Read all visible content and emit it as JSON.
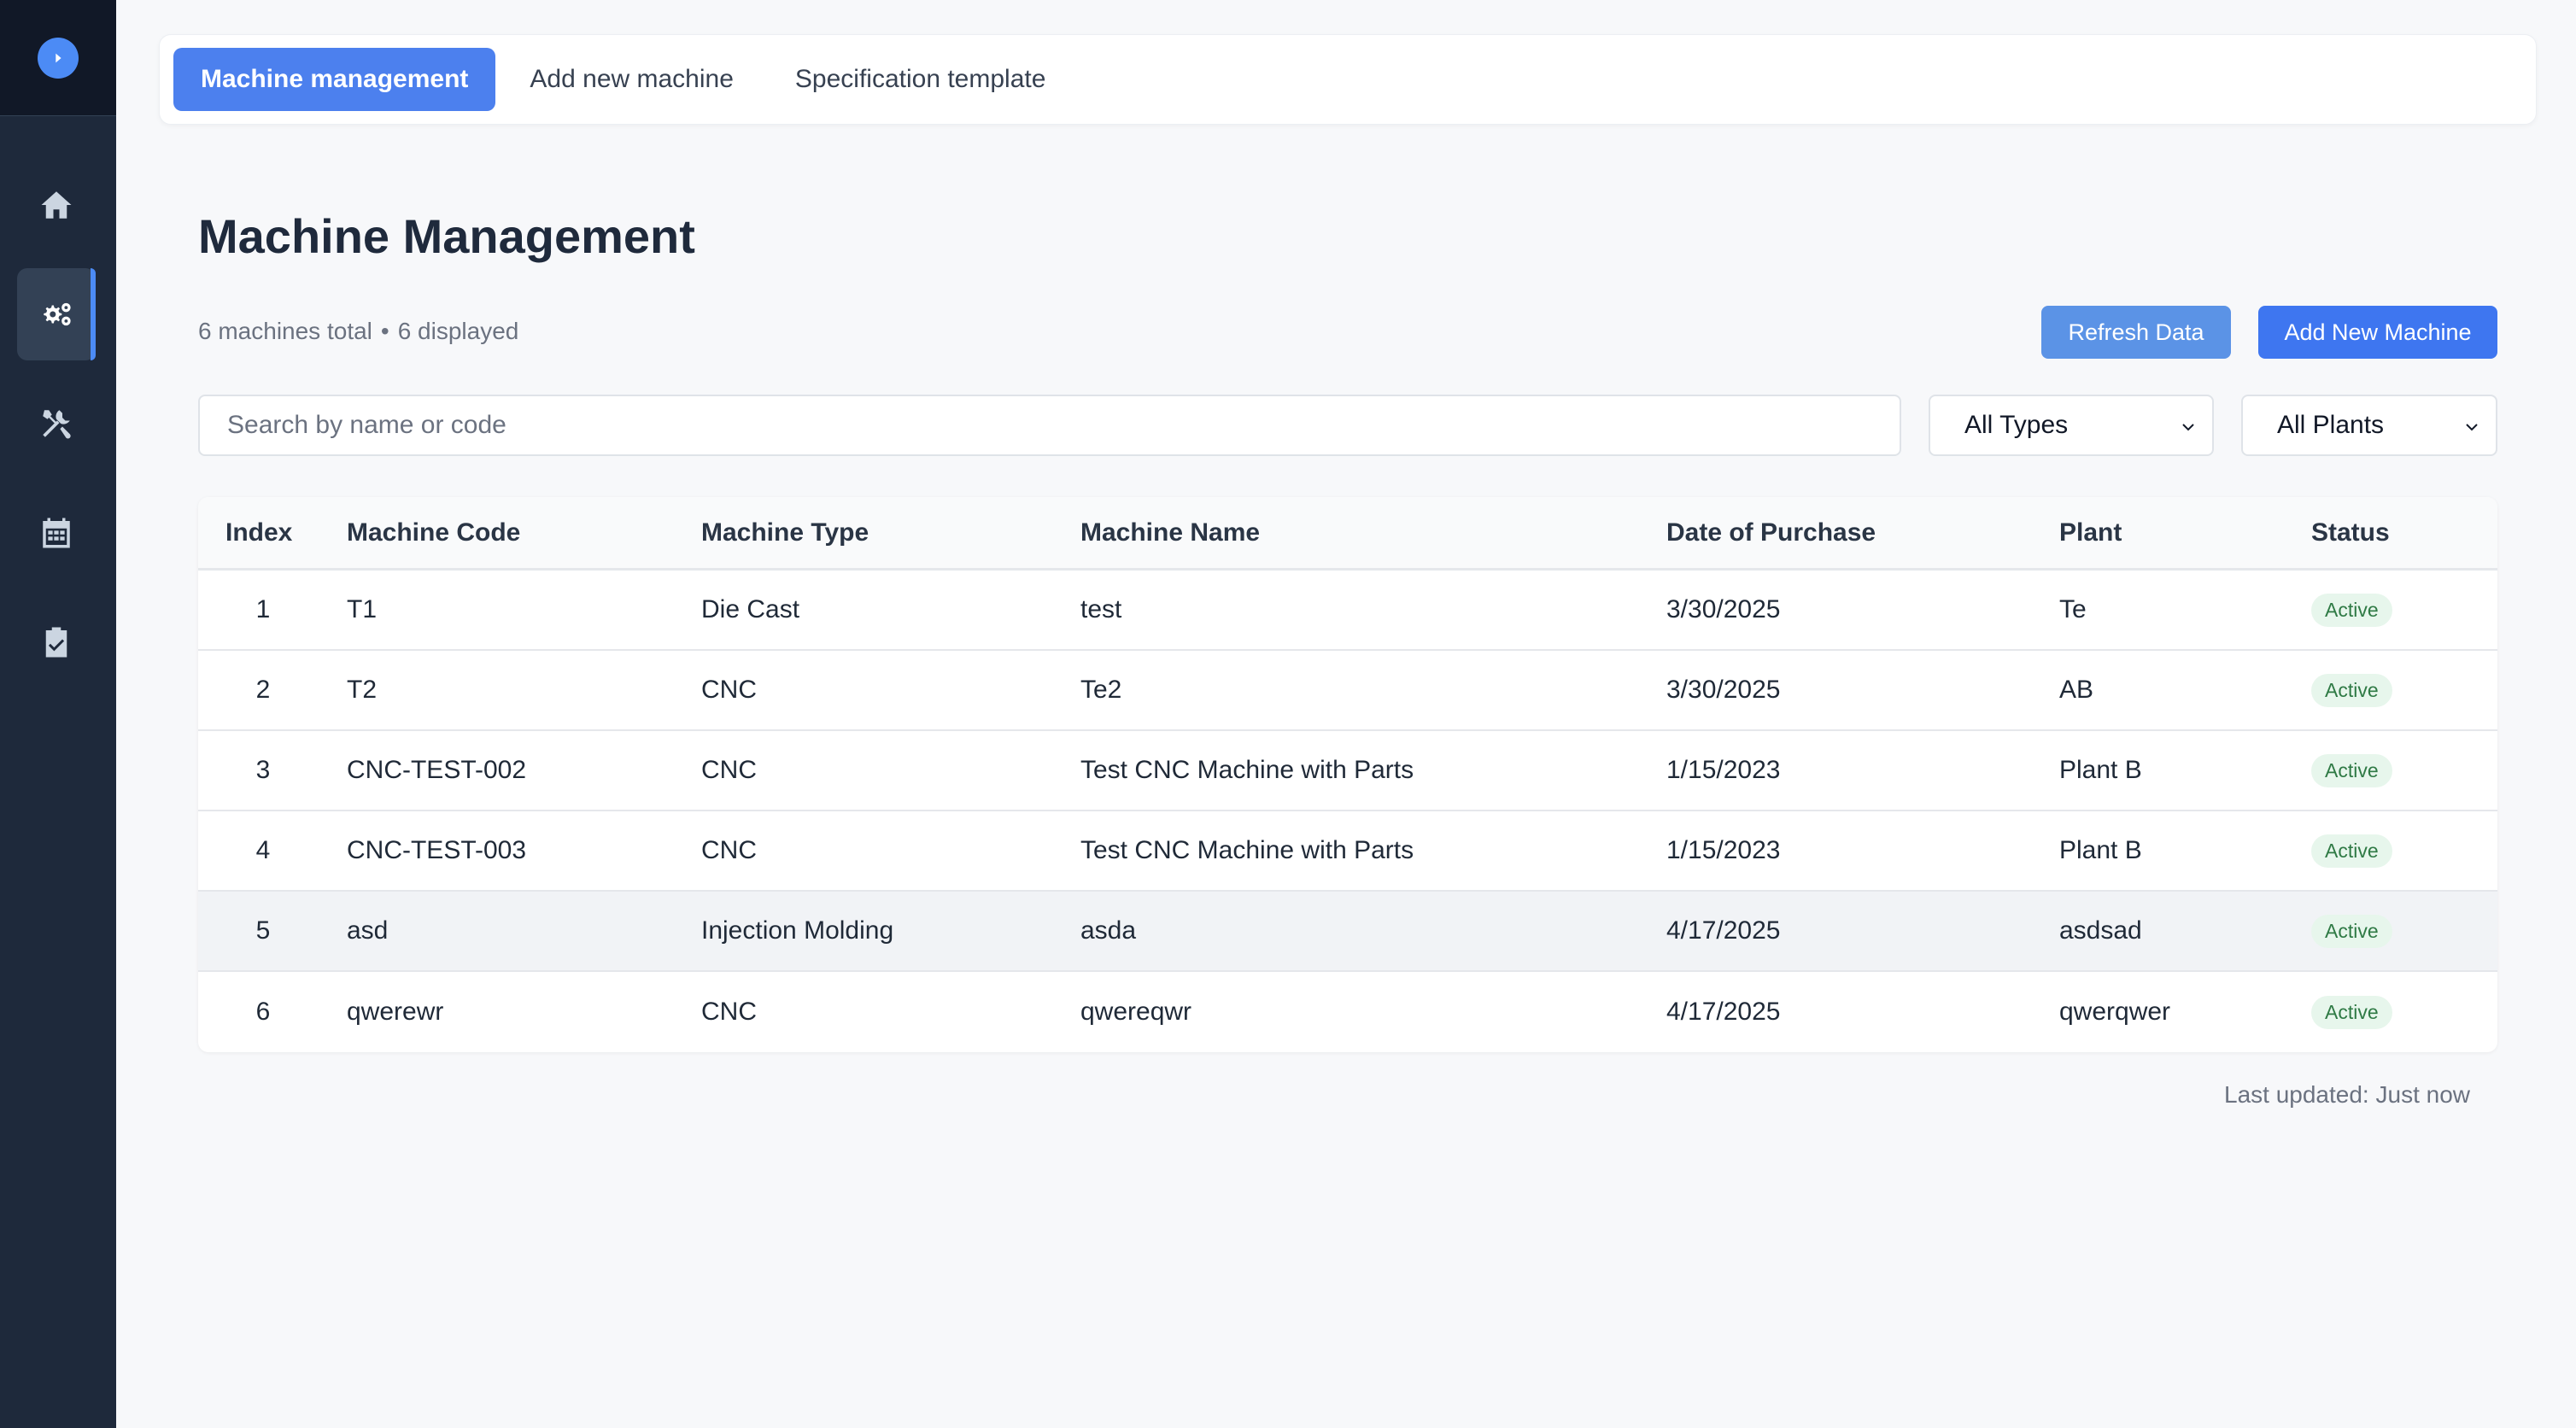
{
  "tabs": [
    {
      "label": "Machine management",
      "active": true
    },
    {
      "label": "Add new machine",
      "active": false
    },
    {
      "label": "Specification template",
      "active": false
    }
  ],
  "page": {
    "title": "Machine Management",
    "total_text": "6 machines total",
    "separator": "•",
    "displayed_text": "6 displayed"
  },
  "actions": {
    "refresh_label": "Refresh Data",
    "add_label": "Add New Machine"
  },
  "filters": {
    "search_placeholder": "Search by name or code",
    "type_selected": "All Types",
    "plant_selected": "All Plants"
  },
  "table": {
    "columns": [
      "Index",
      "Machine Code",
      "Machine Type",
      "Machine Name",
      "Date of Purchase",
      "Plant",
      "Status"
    ],
    "rows": [
      {
        "index": "1",
        "code": "T1",
        "type": "Die Cast",
        "name": "test",
        "date": "3/30/2025",
        "plant": "Te",
        "status": "Active"
      },
      {
        "index": "2",
        "code": "T2",
        "type": "CNC",
        "name": "Te2",
        "date": "3/30/2025",
        "plant": "AB",
        "status": "Active"
      },
      {
        "index": "3",
        "code": "CNC-TEST-002",
        "type": "CNC",
        "name": "Test CNC Machine with Parts",
        "date": "1/15/2023",
        "plant": "Plant B",
        "status": "Active"
      },
      {
        "index": "4",
        "code": "CNC-TEST-003",
        "type": "CNC",
        "name": "Test CNC Machine with Parts",
        "date": "1/15/2023",
        "plant": "Plant B",
        "status": "Active"
      },
      {
        "index": "5",
        "code": "asd",
        "type": "Injection Molding",
        "name": "asda",
        "date": "4/17/2025",
        "plant": "asdsad",
        "status": "Active"
      },
      {
        "index": "6",
        "code": "qwerewr",
        "type": "CNC",
        "name": "qwereqwr",
        "date": "4/17/2025",
        "plant": "qwerqwer",
        "status": "Active"
      }
    ]
  },
  "footer": {
    "last_updated_label": "Last updated:",
    "last_updated_value": "Just now"
  },
  "sidebar": {
    "items": [
      {
        "icon": "home-icon",
        "active": false
      },
      {
        "icon": "gears-icon",
        "active": true
      },
      {
        "icon": "tools-icon",
        "active": false
      },
      {
        "icon": "calendar-icon",
        "active": false
      },
      {
        "icon": "clipboard-check-icon",
        "active": false
      }
    ]
  },
  "colors": {
    "sidebar_bg": "#1e293b",
    "accent": "#4c80ee",
    "status_bg": "#e7f6ec",
    "status_text": "#2f7a45"
  }
}
